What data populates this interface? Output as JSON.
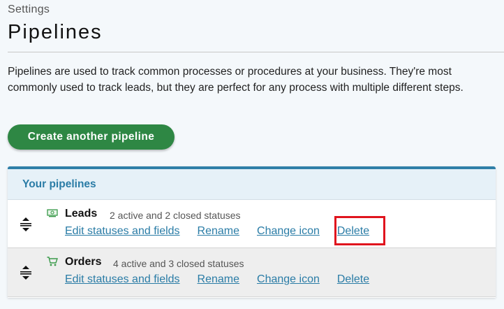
{
  "header": {
    "breadcrumb": "Settings",
    "title": "Pipelines",
    "description": "Pipelines are used to track common processes or procedures at your business. They're most commonly used to track leads, but they are perfect for any process with multiple different steps."
  },
  "create_button": {
    "label": "Create another pipeline"
  },
  "panel": {
    "title": "Your pipelines",
    "pipelines": [
      {
        "name": "Leads",
        "status": "2 active and 2 closed statuses",
        "icon": "money-icon",
        "actions": [
          "Edit statuses and fields",
          "Rename",
          "Change icon",
          "Delete"
        ]
      },
      {
        "name": "Orders",
        "status": "4 active and 3 closed statuses",
        "icon": "cart-icon",
        "actions": [
          "Edit statuses and fields",
          "Rename",
          "Change icon",
          "Delete"
        ]
      }
    ]
  },
  "colors": {
    "accent": "#2a7ca6",
    "button": "#2e8744",
    "highlight": "#e0141e"
  }
}
